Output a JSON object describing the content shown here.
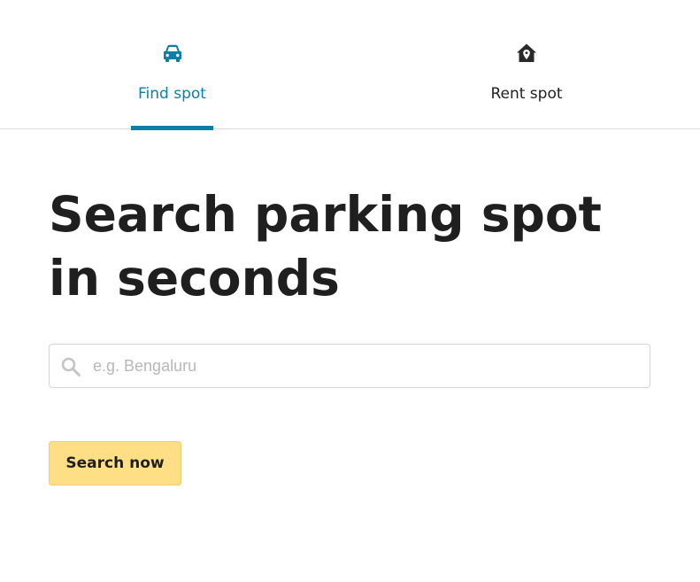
{
  "tabs": [
    {
      "label": "Find spot",
      "icon": "car-icon",
      "active": true,
      "color": "#0b7fa6"
    },
    {
      "label": "Rent spot",
      "icon": "home-location-icon",
      "active": false,
      "color": "#1f1f1f"
    }
  ],
  "headline": {
    "line1": "Search parking spot",
    "line2": "in seconds"
  },
  "search": {
    "placeholder": "e.g. Bengaluru",
    "value": "",
    "icon": "search-icon"
  },
  "search_button": {
    "label": "Search now",
    "color": "#ffdf85"
  },
  "colors": {
    "accent": "#0b7fa6",
    "text": "#1f1f1f",
    "divider": "#dadada"
  }
}
